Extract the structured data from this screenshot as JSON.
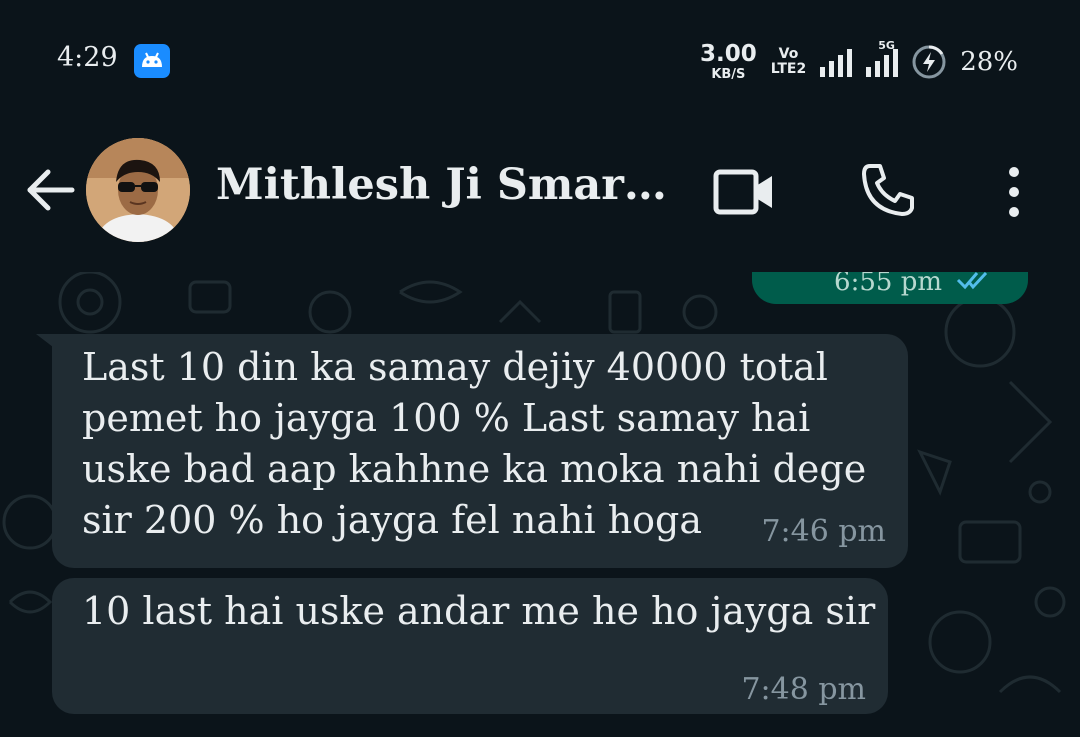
{
  "status_bar": {
    "time": "4:29",
    "speed_value": "3.00",
    "speed_unit": "KB/S",
    "volte_line1": "Vo",
    "volte_line2": "LTE2",
    "network_label": "5G",
    "battery_percent": "28%"
  },
  "header": {
    "contact_name": "Mithlesh Ji Smart D..."
  },
  "messages": [
    {
      "direction": "incoming",
      "text": "Last 10 din ka samay dejiy 40000 total\npemet ho jayga 100 % Last samay hai\nuske bad aap kahhne ka moka nahi dege\nsir 200 % ho jayga fel nahi hoga",
      "time": "7:46 pm"
    },
    {
      "direction": "incoming",
      "text": "10 last hai uske andar me he ho jayga sir",
      "time": "7:48 pm"
    }
  ],
  "partial_outgoing": {
    "time": "6:55 pm"
  },
  "colors": {
    "background": "#0b141a",
    "incoming_bubble": "#202c33",
    "outgoing_bubble": "#005c4b",
    "text": "#e9edef",
    "timestamp": "#8696a0",
    "read_ticks": "#53bdeb",
    "android_badge": "#1a8cff"
  }
}
